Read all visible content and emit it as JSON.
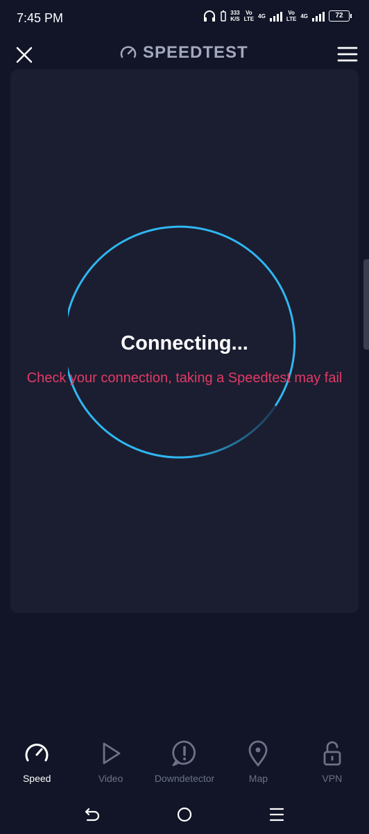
{
  "status_bar": {
    "time": "7:45 PM",
    "net_speed_value": "333",
    "net_speed_unit": "K/S",
    "sim1_volte": "Vo",
    "sim1_lte": "LTE",
    "sim1_tech": "4G",
    "sim2_volte": "Vo",
    "sim2_lte": "LTE",
    "sim2_tech": "4G",
    "battery": "72",
    "icons": [
      "headphones-icon",
      "signal-icon",
      "battery-icon"
    ]
  },
  "header": {
    "brand": "SPEEDTEST",
    "icons": [
      "close-icon",
      "speedometer-icon",
      "hamburger-menu-icon"
    ]
  },
  "main": {
    "status_title": "Connecting...",
    "warning": "Check your connection, taking a Speedtest may fail",
    "ring_color": "#2fb7f2",
    "warning_color": "#e23a66"
  },
  "bottom_nav": {
    "items": [
      {
        "label": "Speed",
        "icon": "speed-gauge-icon",
        "active": true
      },
      {
        "label": "Video",
        "icon": "play-icon",
        "active": false
      },
      {
        "label": "Downdetector",
        "icon": "alert-icon",
        "active": false
      },
      {
        "label": "Map",
        "icon": "map-pin-icon",
        "active": false
      },
      {
        "label": "VPN",
        "icon": "lock-icon",
        "active": false
      }
    ]
  },
  "system_nav": {
    "icons": [
      "back-icon",
      "home-icon",
      "recents-icon"
    ]
  },
  "colors": {
    "background": "#111527",
    "card": "#1b1e30",
    "accent": "#2fb7f2"
  }
}
